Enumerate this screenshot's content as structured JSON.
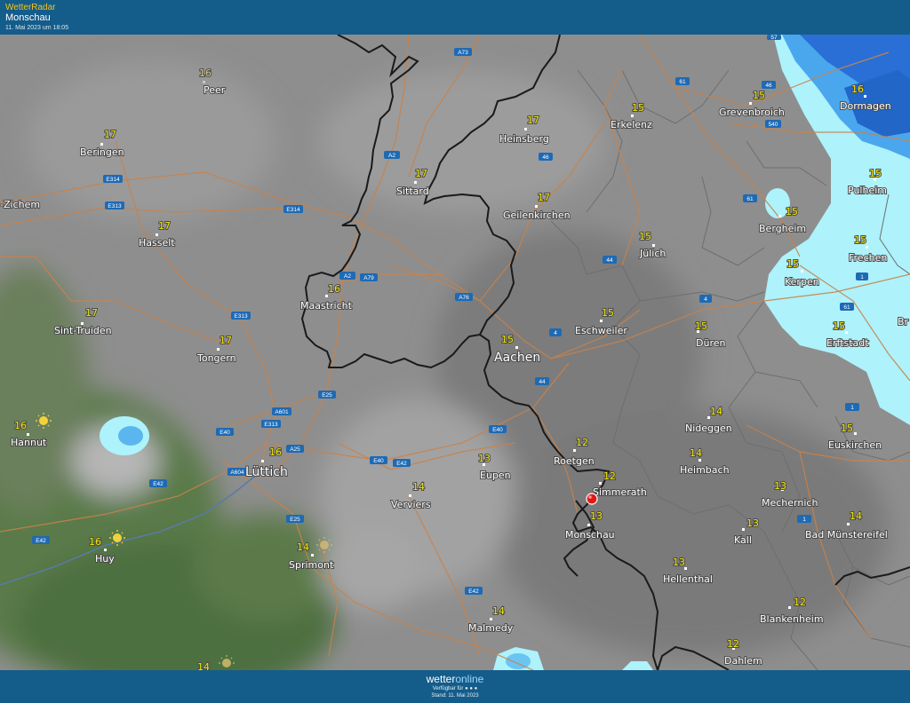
{
  "header": {
    "brand": "WetterRadar",
    "location": "Monschau",
    "timestamp": "11. Mai 2023 um 18:05"
  },
  "footer": {
    "logo_a": "wetter",
    "logo_b": "online",
    "available": "Verfügbar für",
    "stand": "Stand: 11. Mai 2023"
  },
  "colors": {
    "bar": "#145c8a",
    "temperature": "#f2e600",
    "border": "#1a1a1a",
    "road": "#c9824a",
    "rain_light": "#aef2fb",
    "rain_heavy": "#2a6fd6",
    "marker": "#e01818"
  },
  "cities": [
    {
      "name": "Peer",
      "temp": "16",
      "dim": true
    },
    {
      "name": "Beringen",
      "temp": "17"
    },
    {
      "name": "-Zichem",
      "temp": ""
    },
    {
      "name": "Hasselt",
      "temp": "17"
    },
    {
      "name": "Sint-Truiden",
      "temp": "17"
    },
    {
      "name": "Tongern",
      "temp": "17"
    },
    {
      "name": "Hannut",
      "temp": "16",
      "sun": true
    },
    {
      "name": "Huy",
      "temp": "16",
      "sun": true
    },
    {
      "name": "Lüttich",
      "temp": "16",
      "big": true
    },
    {
      "name": "Sprimont",
      "temp": "14",
      "sun": true
    },
    {
      "name": "Maastricht",
      "temp": "16"
    },
    {
      "name": "Sittard",
      "temp": "17"
    },
    {
      "name": "Heinsberg",
      "temp": "17"
    },
    {
      "name": "Geilenkirchen",
      "temp": "17"
    },
    {
      "name": "Erkelenz",
      "temp": "15"
    },
    {
      "name": "Grevenbroich",
      "temp": "15"
    },
    {
      "name": "Dormagen",
      "temp": "16"
    },
    {
      "name": "Pulheim",
      "temp": "15"
    },
    {
      "name": "Bergheim",
      "temp": "15"
    },
    {
      "name": "Frechen",
      "temp": "15"
    },
    {
      "name": "Kerpen",
      "temp": "15"
    },
    {
      "name": "Erftstadt",
      "temp": "15"
    },
    {
      "name": "Jülich",
      "temp": "15"
    },
    {
      "name": "Düren",
      "temp": "15"
    },
    {
      "name": "Eschweiler",
      "temp": "15"
    },
    {
      "name": "Aachen",
      "temp": "15",
      "big": true
    },
    {
      "name": "Verviers",
      "temp": "14"
    },
    {
      "name": "Eupen",
      "temp": "13"
    },
    {
      "name": "Roetgen",
      "temp": "12"
    },
    {
      "name": "Simmerath",
      "temp": "12"
    },
    {
      "name": "Monschau",
      "temp": "13"
    },
    {
      "name": "Nideggen",
      "temp": "14"
    },
    {
      "name": "Heimbach",
      "temp": "14"
    },
    {
      "name": "Euskirchen",
      "temp": "15"
    },
    {
      "name": "Mechernich",
      "temp": "13"
    },
    {
      "name": "Bad Münstereifel",
      "temp": "14"
    },
    {
      "name": "Kall",
      "temp": "13"
    },
    {
      "name": "Hellenthal",
      "temp": "13"
    },
    {
      "name": "Blankenheim",
      "temp": "12"
    },
    {
      "name": "Dahlem",
      "temp": "12"
    },
    {
      "name": "Malmedy",
      "temp": "14"
    },
    {
      "name": "Br",
      "temp": ""
    },
    {
      "name": "",
      "temp": "14",
      "sun": true
    }
  ],
  "roads": [
    "A73",
    "A2",
    "E314",
    "E313",
    "E314",
    "A2",
    "A79",
    "A76",
    "E313",
    "E25",
    "A601",
    "E313",
    "E40",
    "A25",
    "A604",
    "E42",
    "E42",
    "E25",
    "E40",
    "E42",
    "E40",
    "4",
    "44",
    "44",
    "46",
    "61",
    "46",
    "540",
    "61",
    "4",
    "61",
    "1",
    "1",
    "1",
    "E42",
    "57"
  ],
  "icons": {
    "location_marker": "map-pin-icon",
    "sun": "sun-icon"
  }
}
